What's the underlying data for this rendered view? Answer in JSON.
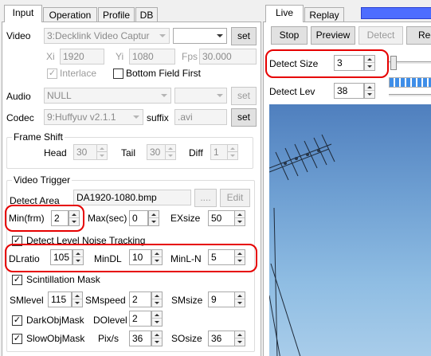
{
  "left_tabs": [
    "Input",
    "Operation",
    "Profile",
    "DB"
  ],
  "right_tabs": [
    "Live",
    "Replay"
  ],
  "video": {
    "label": "Video",
    "device": "3:Decklink Video Captur",
    "set": "set",
    "xi_label": "Xi",
    "xi": "1920",
    "yi_label": "Yi",
    "yi": "1080",
    "fps_label": "Fps",
    "fps": "30.000",
    "interlace_label": "Interlace",
    "bff_label": "Bottom Field First"
  },
  "audio": {
    "label": "Audio",
    "device": "NULL",
    "set": "set"
  },
  "codec": {
    "label": "Codec",
    "value": "9:Huffyuv v2.1.1",
    "suffix_label": "suffix",
    "suffix": ".avi",
    "set": "set"
  },
  "frame_shift": {
    "title": "Frame Shift",
    "head_label": "Head",
    "head": "30",
    "tail_label": "Tail",
    "tail": "30",
    "diff_label": "Diff",
    "diff": "1"
  },
  "video_trigger": {
    "title": "Video Trigger",
    "detect_area_label": "Detect Area",
    "detect_area": "DA1920-1080.bmp",
    "browse": "....",
    "edit": "Edit",
    "min_label": "Min(frm)",
    "min": "2",
    "max_label": "Max(sec)",
    "max": "0",
    "exsize_label": "EXsize",
    "exsize": "50",
    "noise_tracking_label": "Detect Level Noise Tracking",
    "dlratio_label": "DLratio",
    "dlratio": "105",
    "mindl_label": "MinDL",
    "mindl": "10",
    "minln_label": "MinL-N",
    "minln": "5",
    "scint_label": "Scintillation Mask",
    "smlevel_label": "SMlevel",
    "smlevel": "115",
    "smspeed_label": "SMspeed",
    "smspeed": "2",
    "smsize_label": "SMsize",
    "smsize": "9",
    "darkobj_label": "DarkObjMask",
    "dolevel_label": "DOlevel",
    "dolevel": "2",
    "slowobj_label": "SlowObjMask",
    "pixs_label": "Pix/s",
    "pixs": "36",
    "sosize_label": "SOsize",
    "sosize": "36"
  },
  "live": {
    "stop": "Stop",
    "preview": "Preview",
    "detect": "Detect",
    "rec": "Rec",
    "detect_size_label": "Detect Size",
    "detect_size": "3",
    "detect_lev_label": "Detect Lev",
    "detect_lev": "38"
  },
  "colors": {
    "highlight": "#e60000",
    "meter_blue": "#3f8ee8",
    "accent_blue": "#4d6dff",
    "sky": "#8fbde3"
  }
}
